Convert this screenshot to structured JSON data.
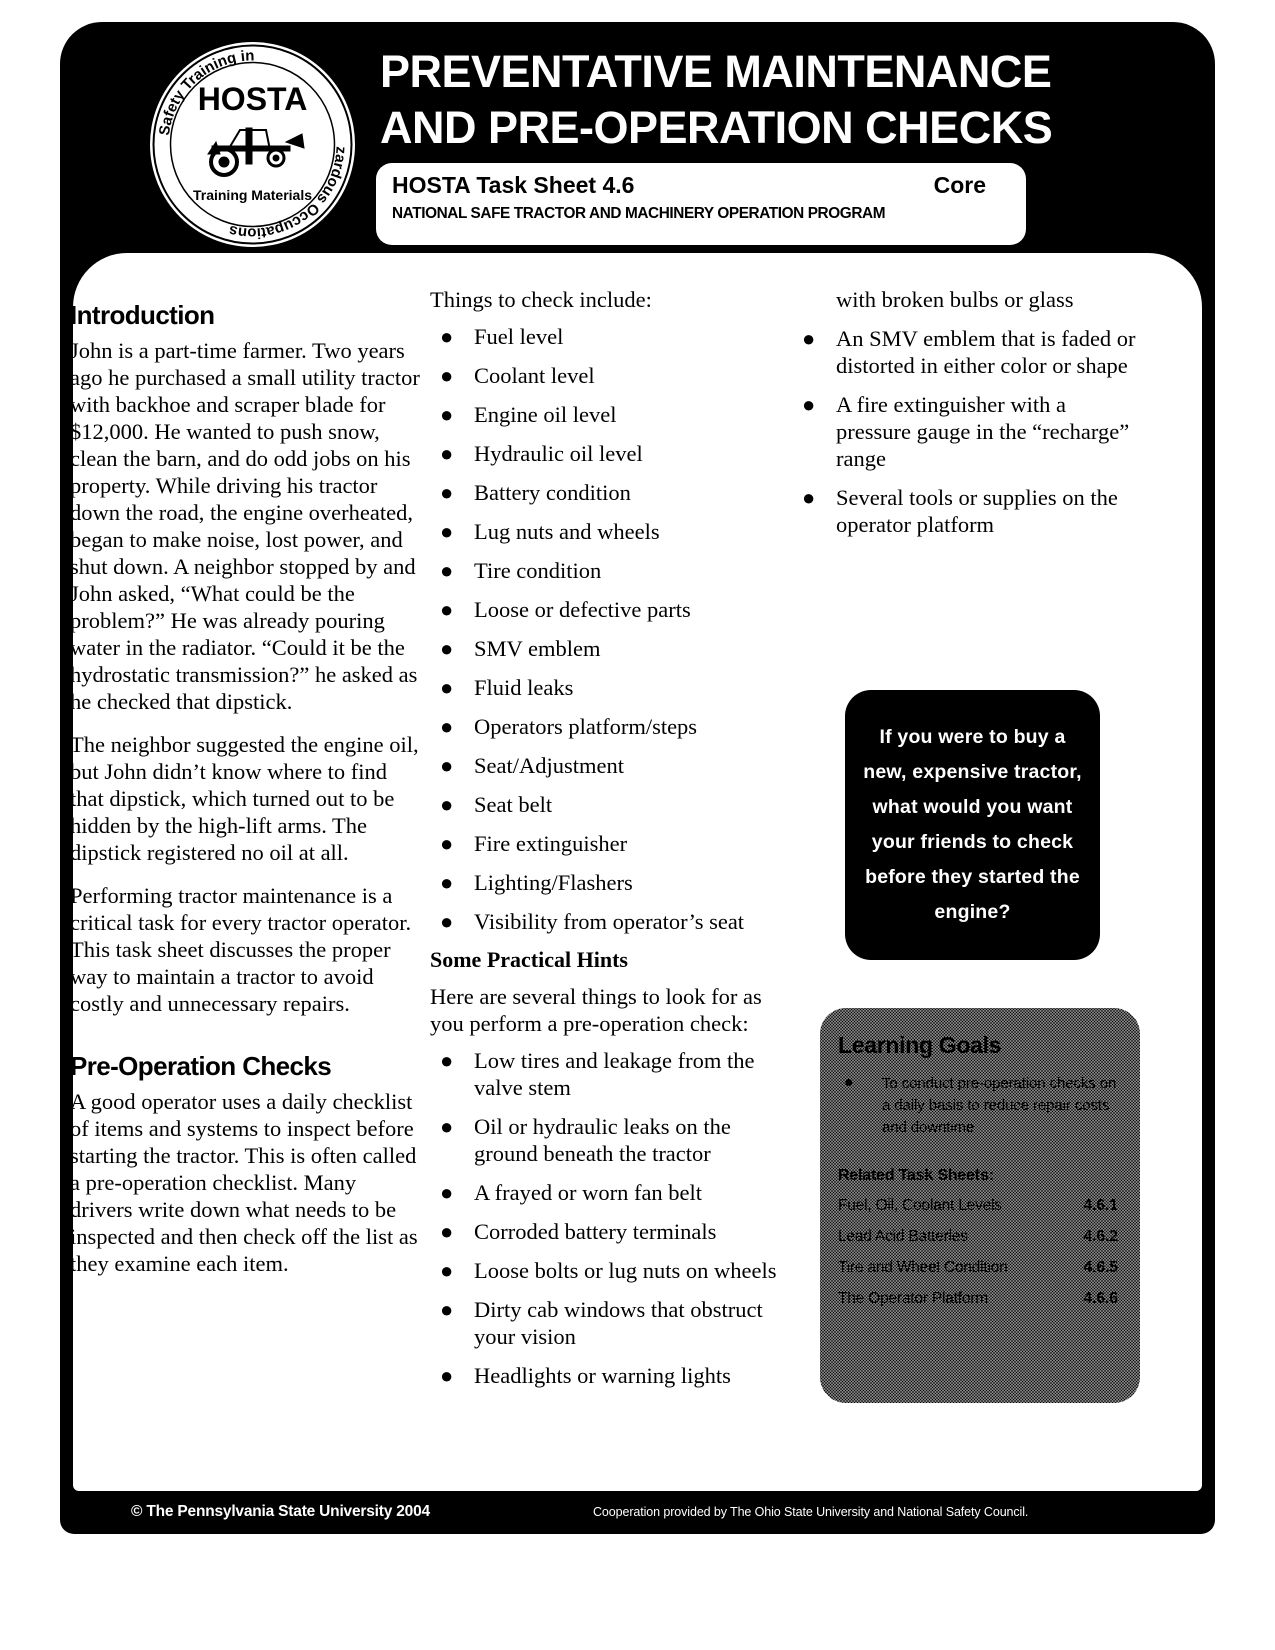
{
  "header": {
    "title": "PREVENTATIVE MAINTENANCE\nAND PRE-OPERATION CHECKS",
    "task_sheet": "HOSTA Task Sheet 4.6",
    "core_label": "Core",
    "program": "NATIONAL SAFE TRACTOR AND MACHINERY OPERATION PROGRAM",
    "logo": {
      "center_text": "HOSTA",
      "ring_text": "Hazardous Occupations Safety Training in Agriculture",
      "sub_text": "Training Materials"
    }
  },
  "column1": {
    "intro_heading": "Introduction",
    "intro_p1": "John is a part-time farmer. Two years ago he purchased a small utility tractor with backhoe and scraper blade for $12,000. He wanted to push snow, clean the barn, and do odd jobs on his property. While driving his tractor down the road, the engine overheated, began to make noise, lost power, and shut down. A neighbor stopped by and John asked, “What could be the problem?” He was already pouring water in the radiator. “Could it be the hydrostatic transmission?” he asked as he checked that dipstick.",
    "intro_p2": "The neighbor suggested the engine oil, but John didn’t know where to find that dipstick, which turned out to be hidden by the high-lift arms. The dipstick registered no oil at all.",
    "intro_p3": "Performing tractor maintenance is a critical task for every tractor operator. This task sheet discusses the proper way to maintain a tractor to avoid costly and unnecessary repairs.",
    "preop_heading": "Pre-Operation Checks",
    "preop_p1": "A good operator uses a daily checklist of items and systems to inspect before starting the tractor. This is often called a pre-operation checklist. Many drivers write down what needs to be inspected and then check off the list as they examine each item."
  },
  "column2": {
    "things_lead": "Things to check include:",
    "things_items": [
      "Fuel level",
      "Coolant level",
      "Engine oil level",
      "Hydraulic oil level",
      "Battery condition",
      "Lug nuts and wheels",
      "Tire condition",
      "Loose or defective parts",
      "SMV emblem",
      "Fluid leaks",
      "Operators platform/steps",
      "Seat/Adjustment",
      "Seat belt",
      "Fire extinguisher",
      "Lighting/Flashers",
      "Visibility from operator’s seat"
    ],
    "hints_heading": "Some Practical Hints",
    "hints_lead": "Here are several things to look for as you perform a pre-operation check:",
    "hints_items": [
      "Low tires and leakage from the valve stem",
      "Oil or hydraulic leaks on the ground beneath the tractor",
      "A frayed or worn fan belt",
      "Corroded battery terminals",
      "Loose bolts or lug nuts on wheels",
      "Dirty cab windows that obstruct your vision",
      "Headlights or warning lights"
    ]
  },
  "column3": {
    "continuation": "with broken bulbs or glass",
    "items": [
      "An SMV emblem that is faded or distorted in either color or shape",
      "A fire extinguisher with a pressure gauge in the “recharge” range",
      "Several tools or supplies on the operator platform"
    ]
  },
  "callout": {
    "text": "If you were to buy a new, expensive tractor, what would you want your friends to check before they started the engine?"
  },
  "learning_goals": {
    "title": "Learning Goals",
    "goals": [
      "To conduct pre-operation checks on a daily basis to reduce repair costs and downtime"
    ],
    "related_title": "Related Task Sheets:",
    "related": [
      {
        "name": "Fuel, Oil, Coolant Levels",
        "number": "4.6.1"
      },
      {
        "name": "Lead Acid Batteries",
        "number": "4.6.2"
      },
      {
        "name": "Tire and Wheel Condition",
        "number": "4.6.5"
      },
      {
        "name": "The Operator Platform",
        "number": "4.6.6"
      }
    ]
  },
  "footer": {
    "copyright": "© The Pennsylvania State University 2004",
    "cooperation": "Cooperation provided by The Ohio State University and National Safety Council."
  }
}
